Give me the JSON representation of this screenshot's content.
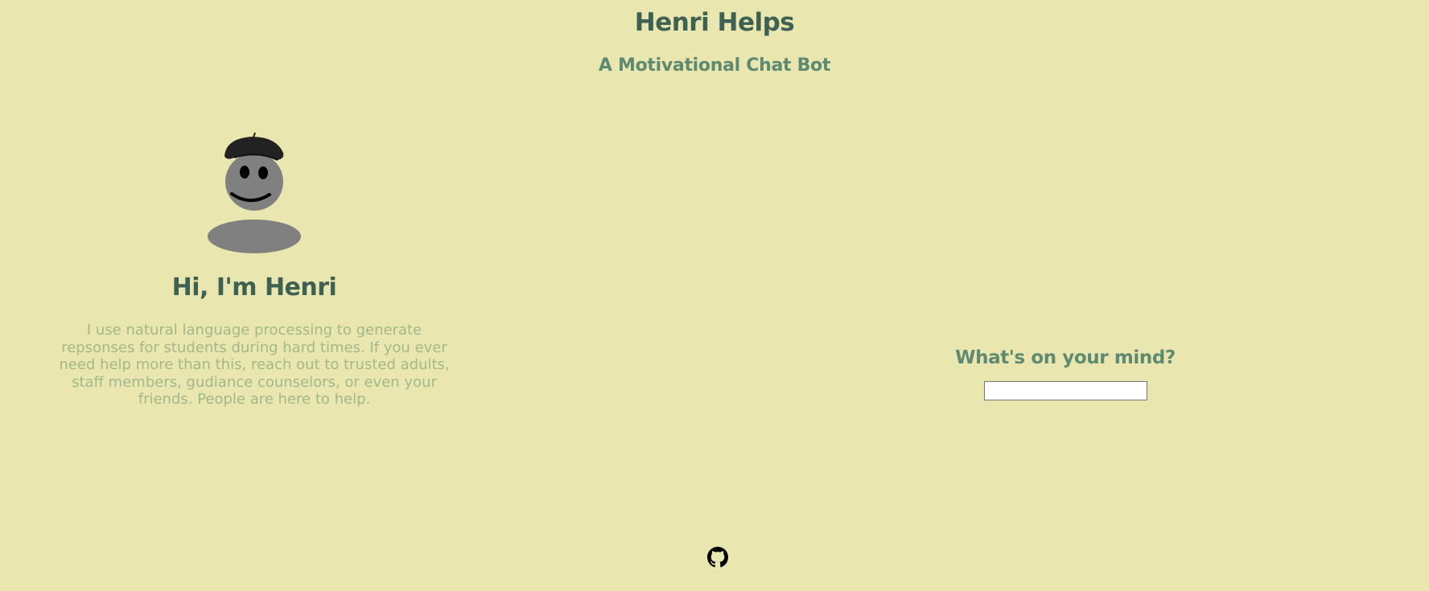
{
  "header": {
    "title": "Henri Helps",
    "subtitle": "A Motivational Chat Bot"
  },
  "intro": {
    "avatar_icon": "henri-beret-smiley-icon",
    "heading": "Hi, I'm Henri",
    "description": "I use natural language processing to generate repsonses for students during hard times. If you ever need help more than this, reach out to trusted adults, staff members, gudiance counselors, or even your friends. People are here to help."
  },
  "chat": {
    "prompt": "What's on your mind?",
    "input_value": "",
    "input_placeholder": ""
  },
  "footer": {
    "link_icon": "github-icon"
  },
  "colors": {
    "background": "#eae6b0",
    "title": "#3f6153",
    "subtitle": "#5e8a72",
    "description": "#a3b88a"
  }
}
